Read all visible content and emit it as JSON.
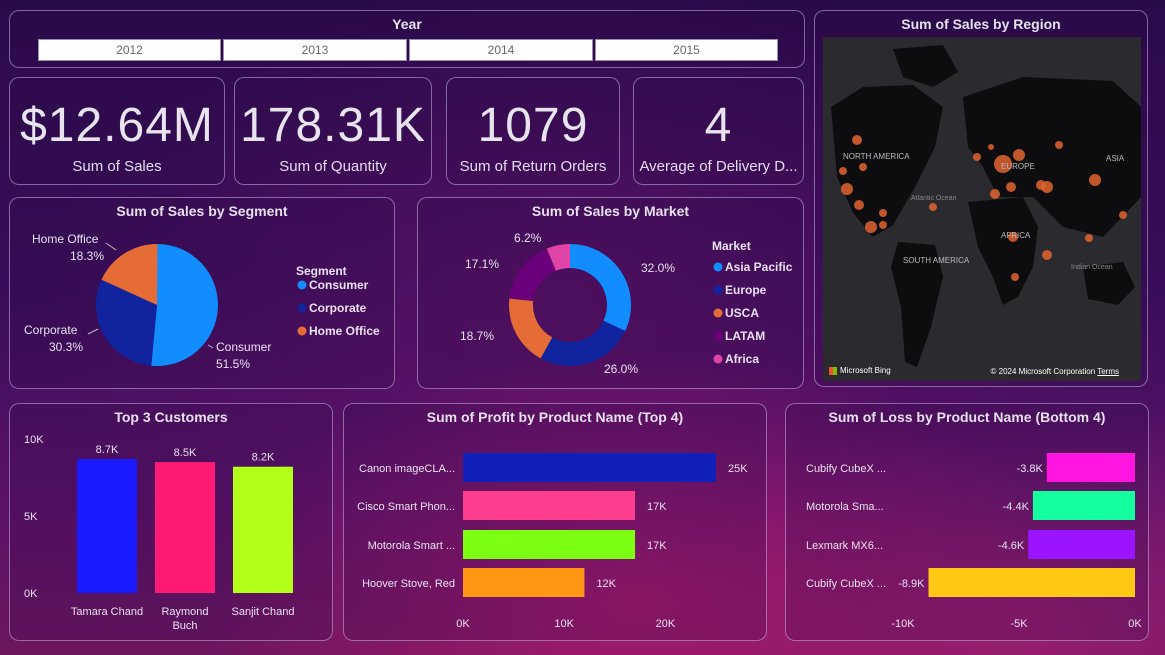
{
  "year_slicer": {
    "title": "Year",
    "options": [
      "2012",
      "2013",
      "2014",
      "2015"
    ]
  },
  "kpis": [
    {
      "value": "$12.64M",
      "label": "Sum of Sales"
    },
    {
      "value": "178.31K",
      "label": "Sum of Quantity"
    },
    {
      "value": "1079",
      "label": "Sum of Return Orders"
    },
    {
      "value": "4",
      "label": "Average of Delivery D..."
    }
  ],
  "map": {
    "title": "Sum of Sales by Region",
    "labels": [
      "NORTH AMERICA",
      "EUROPE",
      "ASIA",
      "Atlantic Ocean",
      "AFRICA",
      "SOUTH AMERICA",
      "Indian Ocean"
    ],
    "attribution": "Microsoft Bing",
    "copyright": "© 2024 Microsoft Corporation",
    "terms": "Terms"
  },
  "colors": {
    "consumer": "#118dff",
    "corporate": "#12239e",
    "home_office": "#e66c37",
    "asia_pacific": "#118dff",
    "europe": "#12239e",
    "usca": "#e66c37",
    "latam": "#6b007b",
    "africa": "#e044a7",
    "map_bubble": "#e0642e",
    "map_land": "#0d0d0f",
    "map_water": "#2b2b2f"
  },
  "chart_data": [
    {
      "type": "pie",
      "title": "Sum of Sales by Segment",
      "legend_title": "Segment",
      "legend_placement": "right",
      "slices": [
        {
          "name": "Consumer",
          "percent": 51.5,
          "pct_label": "51.5%"
        },
        {
          "name": "Corporate",
          "percent": 30.3,
          "pct_label": "30.3%"
        },
        {
          "name": "Home Office",
          "percent": 18.3,
          "pct_label": "18.3%"
        }
      ]
    },
    {
      "type": "pie",
      "title": "Sum of Sales by Market",
      "legend_title": "Market",
      "legend_placement": "right",
      "donut": true,
      "slices": [
        {
          "name": "Asia Pacific",
          "percent": 32.0,
          "pct_label": "32.0%"
        },
        {
          "name": "Europe",
          "percent": 26.0,
          "pct_label": "26.0%"
        },
        {
          "name": "USCA",
          "percent": 18.7,
          "pct_label": "18.7%"
        },
        {
          "name": "LATAM",
          "percent": 17.1,
          "pct_label": "17.1%"
        },
        {
          "name": "Africa",
          "percent": 6.2,
          "pct_label": "6.2%"
        }
      ]
    },
    {
      "type": "bar",
      "title": "Top 3 Customers",
      "categories": [
        "Tamara Chand",
        "Raymond Buch",
        "Sanjit Chand"
      ],
      "values": [
        8700,
        8500,
        8200
      ],
      "data_labels": [
        "8.7K",
        "8.5K",
        "8.2K"
      ],
      "colors": [
        "#1a1aff",
        "#ff1a75",
        "#b3ff1a"
      ],
      "y_ticks": [
        "0K",
        "5K",
        "10K"
      ],
      "ylim": [
        0,
        10000
      ]
    },
    {
      "type": "bar",
      "orientation": "horizontal",
      "title": "Sum of Profit by Product Name (Top 4)",
      "categories": [
        "Canon imageCLA...",
        "Cisco Smart Phon...",
        "Motorola Smart ...",
        "Hoover Stove, Red"
      ],
      "values": [
        25000,
        17000,
        17000,
        12000
      ],
      "data_labels": [
        "25K",
        "17K",
        "17K",
        "12K"
      ],
      "colors": [
        "#1020b8",
        "#ff3d8f",
        "#7dff14",
        "#ff9614"
      ],
      "x_ticks": [
        "0K",
        "10K",
        "20K"
      ],
      "xlim": [
        0,
        25000
      ]
    },
    {
      "type": "bar",
      "orientation": "horizontal",
      "title": "Sum of Loss by Product Name (Bottom 4)",
      "categories": [
        "Cubify CubeX ...",
        "Motorola Sma...",
        "Lexmark MX6...",
        "Cubify CubeX ..."
      ],
      "values": [
        -3800,
        -4400,
        -4600,
        -8900
      ],
      "data_labels": [
        "-3.8K",
        "-4.4K",
        "-4.6K",
        "-8.9K"
      ],
      "colors": [
        "#ff14e0",
        "#14ff9e",
        "#9b14ff",
        "#ffc814"
      ],
      "x_ticks": [
        "-10K",
        "-5K",
        "0K"
      ],
      "xlim": [
        -10000,
        0
      ]
    }
  ]
}
